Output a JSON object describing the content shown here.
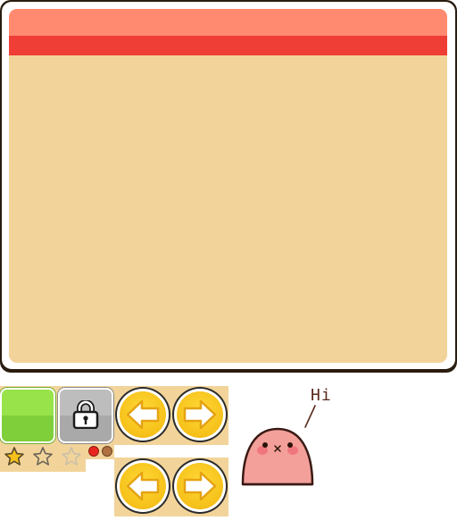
{
  "panel": {
    "header_color_top": "#ff8a70",
    "header_color_bottom": "#ef3e36",
    "body_color": "#f2d49a"
  },
  "tiles": [
    {
      "state": "unlocked",
      "color": "#8ed942"
    },
    {
      "state": "locked",
      "icon": "lock-icon",
      "color": "#b3b3b3"
    }
  ],
  "stars": [
    {
      "state": "filled",
      "color": "#f6c11a"
    },
    {
      "state": "empty"
    },
    {
      "state": "empty-faded"
    }
  ],
  "indicator_dots": [
    {
      "state": "active",
      "color": "#e8261f"
    },
    {
      "state": "inactive",
      "color": "#b07040"
    }
  ],
  "buttons": {
    "prev_icon": "arrow-left-icon",
    "next_icon": "arrow-right-icon",
    "color": "#f6c11a"
  },
  "character": {
    "speech": "Hi",
    "color": "#f4a09a"
  }
}
